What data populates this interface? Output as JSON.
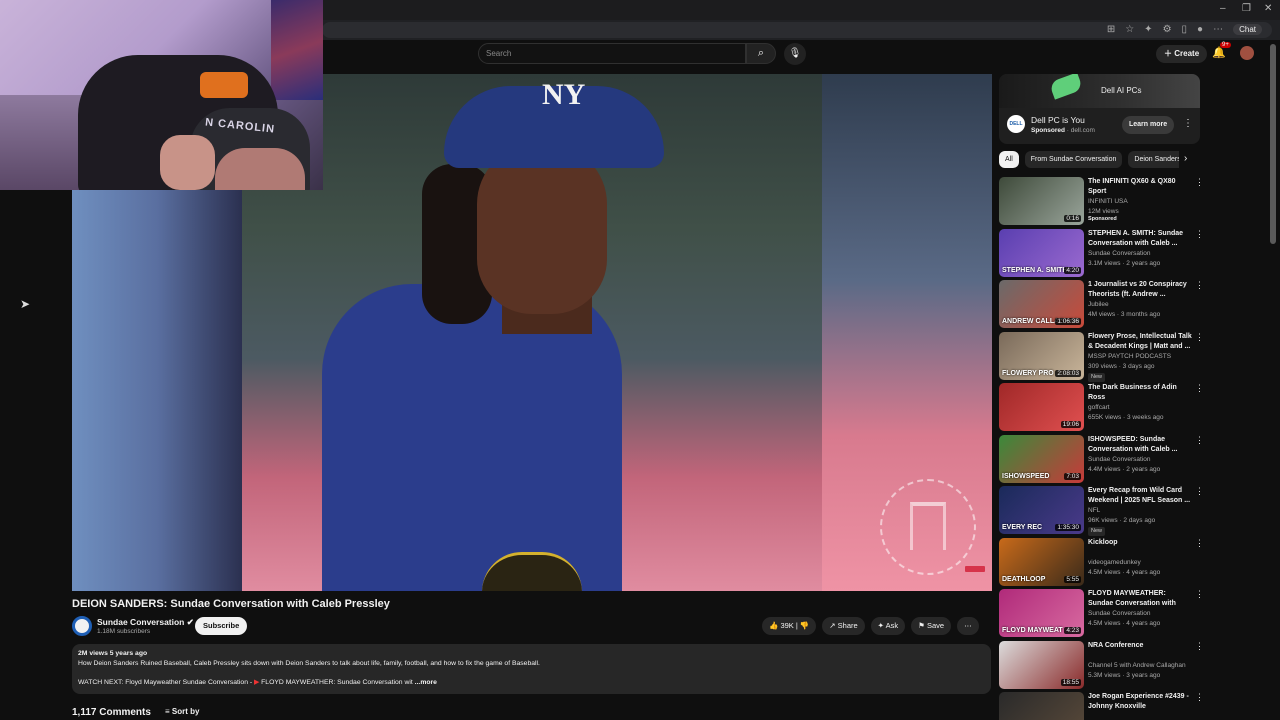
{
  "youtube": {
    "search_placeholder": "Search",
    "create_label": "Create",
    "notif_count": "9+"
  },
  "browser": {
    "chat_label": "Chat"
  },
  "webcam": {
    "hat_text": "N CAROLIN"
  },
  "video": {
    "hat_logo": "NY",
    "title": "DEION SANDERS: Sundae Conversation with Caleb Pressley",
    "channel": "Sundae Conversation",
    "subscribers": "1.18M subscribers",
    "subscribe_label": "Subscribe",
    "likes": "39K",
    "share_label": "Share",
    "ask_label": "Ask",
    "save_label": "Save",
    "views_age": "2M views  5 years ago",
    "description": "How Deion Sanders Ruined Baseball, Caleb Pressley sits down with Deion Sanders to talk about life, family, football, and how to fix the game of Baseball.",
    "watch_next": "WATCH NEXT: Floyd Mayweather Sundae Conversation - ",
    "watch_next_link": "FLOYD MAYWEATHER: Sundae Conversation wit",
    "more_label": "...more",
    "comments_count": "1,117 Comments",
    "sort_label": "Sort by"
  },
  "ad": {
    "banner_text": "Dell AI PCs",
    "logo_text": "DELL",
    "title": "Dell PC is You",
    "sponsored": "Sponsored",
    "domain": "· dell.com",
    "learn_more": "Learn more"
  },
  "chips": [
    "All",
    "From Sundae Conversation",
    "Deion Sanders"
  ],
  "recommendations": [
    {
      "title": "The INFINITI QX60 & QX80 Sport",
      "channel": "INFINITI USA",
      "meta": "12M views",
      "badge": "Sponsored",
      "duration": "0:16",
      "caption": "",
      "colors": [
        "#3e4a3a",
        "#9aa59b"
      ]
    },
    {
      "title": "STEPHEN A. SMITH: Sundae Conversation with Caleb ...",
      "channel": "Sundae Conversation",
      "meta": "3.1M views · 2 years ago",
      "badge": "",
      "duration": "4:20",
      "caption": "STEPHEN A. SMITH",
      "colors": [
        "#5a3fb0",
        "#9b6ad0"
      ]
    },
    {
      "title": "1 Journalist vs 20 Conspiracy Theorists (ft. Andrew ...",
      "channel": "Jubilee",
      "meta": "4M views · 3 months ago",
      "badge": "",
      "duration": "1:06:36",
      "caption": "ANDREW CALLAGHAN",
      "colors": [
        "#6a6a6a",
        "#c94a3a"
      ]
    },
    {
      "title": "Flowery Prose, Intellectual Talk & Decadent Kings | Matt and ...",
      "channel": "MSSP PAYTCH PODCASTS",
      "meta": "309 views · 3 days ago",
      "badge": "New",
      "duration": "2:08:03",
      "caption": "FLOWERY PRO",
      "colors": [
        "#7a6a5a",
        "#c9b59a"
      ]
    },
    {
      "title": "The Dark Business of Adin Ross",
      "channel": "goffcart",
      "meta": "655K views · 3 weeks ago",
      "badge": "",
      "duration": "19:06",
      "caption": "",
      "colors": [
        "#a02828",
        "#e05050"
      ]
    },
    {
      "title": "ISHOWSPEED: Sundae Conversation with Caleb ...",
      "channel": "Sundae Conversation",
      "meta": "4.4M views · 2 years ago",
      "badge": "",
      "duration": "7:03",
      "caption": "ISHOWSPEED",
      "colors": [
        "#3a8a3a",
        "#c83a3a"
      ]
    },
    {
      "title": "Every Recap from Wild Card Weekend | 2025 NFL Season ...",
      "channel": "NFL",
      "meta": "96K views · 2 days ago",
      "badge": "New",
      "duration": "1:35:30",
      "caption": "EVERY REC",
      "colors": [
        "#1a2a5a",
        "#4a3a8a"
      ]
    },
    {
      "title": "Kickloop",
      "channel": "videogamedunkey",
      "meta": "4.5M views · 4 years ago",
      "badge": "",
      "duration": "5:55",
      "caption": "DEATHLOOP",
      "colors": [
        "#c86a1a",
        "#3a2a1a"
      ]
    },
    {
      "title": "FLOYD MAYWEATHER: Sundae Conversation with Caleb ...",
      "channel": "Sundae Conversation",
      "meta": "4.5M views · 4 years ago",
      "badge": "",
      "duration": "4:23",
      "caption": "FLOYD MAYWEAT",
      "colors": [
        "#b02a7a",
        "#d86aa0"
      ]
    },
    {
      "title": "NRA Conference",
      "channel": "Channel 5 with Andrew Callaghan",
      "meta": "5.3M views · 3 years ago",
      "badge": "",
      "duration": "18:55",
      "caption": "",
      "colors": [
        "#dcdcdc",
        "#8a2a2a"
      ]
    },
    {
      "title": "Joe Rogan Experience #2439 - Johnny Knoxville",
      "channel": "",
      "meta": "",
      "badge": "",
      "duration": "",
      "caption": "",
      "colors": [
        "#2a2a2a",
        "#5a4a3a"
      ]
    }
  ]
}
